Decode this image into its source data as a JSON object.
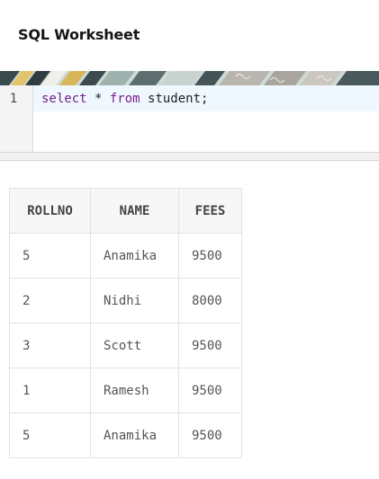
{
  "worksheet": {
    "title": "SQL Worksheet"
  },
  "editor": {
    "line_number": "1",
    "tokens": [
      {
        "text": "select",
        "kind": "keyword"
      },
      {
        "text": " * ",
        "kind": "plain"
      },
      {
        "text": "from",
        "kind": "keyword"
      },
      {
        "text": " student;",
        "kind": "plain"
      }
    ]
  },
  "colors": {
    "keyword": "#7a1f8a",
    "active_line": "#eef8fe"
  },
  "results": {
    "columns": [
      "ROLLNO",
      "NAME",
      "FEES"
    ],
    "rows": [
      [
        "5",
        "Anamika",
        "9500"
      ],
      [
        "2",
        "Nidhi",
        "8000"
      ],
      [
        "3",
        "Scott",
        "9500"
      ],
      [
        "1",
        "Ramesh",
        "9500"
      ],
      [
        "5",
        "Anamika",
        "9500"
      ]
    ]
  }
}
